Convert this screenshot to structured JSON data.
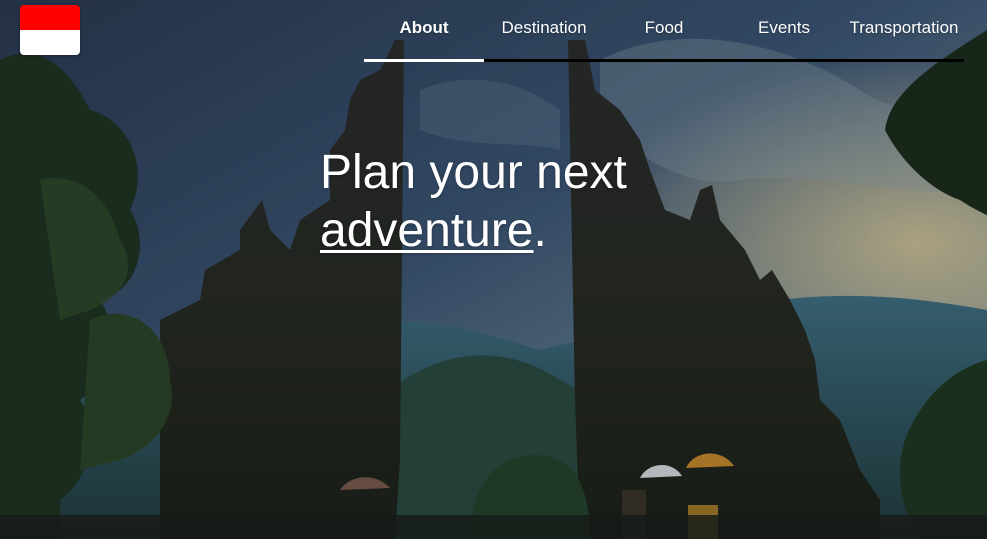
{
  "nav": {
    "items": [
      {
        "label": "About",
        "active": true
      },
      {
        "label": "Destination",
        "active": false
      },
      {
        "label": "Food",
        "active": false
      },
      {
        "label": "Events",
        "active": false
      },
      {
        "label": "Transportation",
        "active": false
      }
    ]
  },
  "hero": {
    "headline_line1": "Plan your next",
    "headline_link": "adventure",
    "headline_end": "."
  },
  "logo": {
    "flag_top_color": "#ff0000",
    "flag_bottom_color": "#ffffff"
  },
  "colors": {
    "nav_track": "#000000",
    "nav_indicator": "#ffffff",
    "text": "#ffffff"
  }
}
